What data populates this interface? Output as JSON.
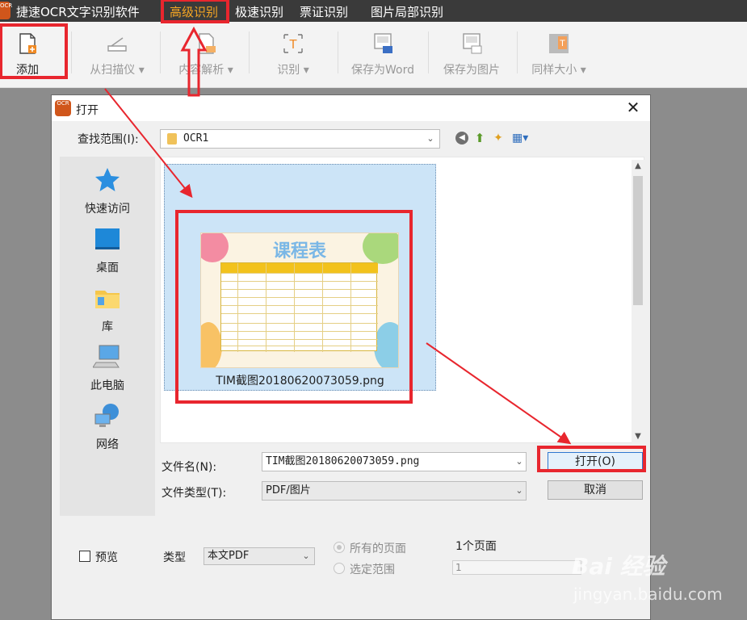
{
  "app": {
    "title": "捷速OCR文字识别软件",
    "logo_text": "OCR",
    "menu": [
      "高级识别",
      "极速识别",
      "票证识别",
      "图片局部识别"
    ],
    "active_menu_index": 0
  },
  "toolbar": {
    "items": [
      {
        "label": "添加",
        "icon": "add-file-icon",
        "enabled": true
      },
      {
        "label": "从扫描仪 ▾",
        "icon": "scanner-icon",
        "enabled": false
      },
      {
        "label": "内容解析 ▾",
        "icon": "parse-icon",
        "enabled": false
      },
      {
        "label": "识别 ▾",
        "icon": "recognize-icon",
        "enabled": false
      },
      {
        "label": "保存为Word",
        "icon": "save-word-icon",
        "enabled": false
      },
      {
        "label": "保存为图片",
        "icon": "save-image-icon",
        "enabled": false
      },
      {
        "label": "同样大小 ▾",
        "icon": "same-size-icon",
        "enabled": false
      }
    ]
  },
  "dialog": {
    "title": "打开",
    "close_glyph": "✕",
    "look_in_label": "查找范围(I):",
    "look_in_value": "OCR1",
    "places": [
      "快速访问",
      "桌面",
      "库",
      "此电脑",
      "网络"
    ],
    "file": {
      "name": "TIM截图20180620073059.png",
      "thumb_title": "课程表"
    },
    "filename_label": "文件名(N):",
    "filename_value": "TIM截图20180620073059.png",
    "filetype_label": "文件类型(T):",
    "filetype_value": "PDF/图片",
    "open_button": "打开(O)",
    "cancel_button": "取消",
    "preview_label": "预览",
    "type_label": "类型",
    "type_value": "本文PDF",
    "all_pages_label": "所有的页面",
    "range_label": "选定范围",
    "pages_count_label": "1个页面",
    "pages_value": "1"
  },
  "watermark": {
    "logo": "Bai 经验",
    "site": "jingyan.baidu.com"
  },
  "colors": {
    "highlight": "#e8262e",
    "active_menu": "#f5a623",
    "selection": "#cce4f7"
  }
}
